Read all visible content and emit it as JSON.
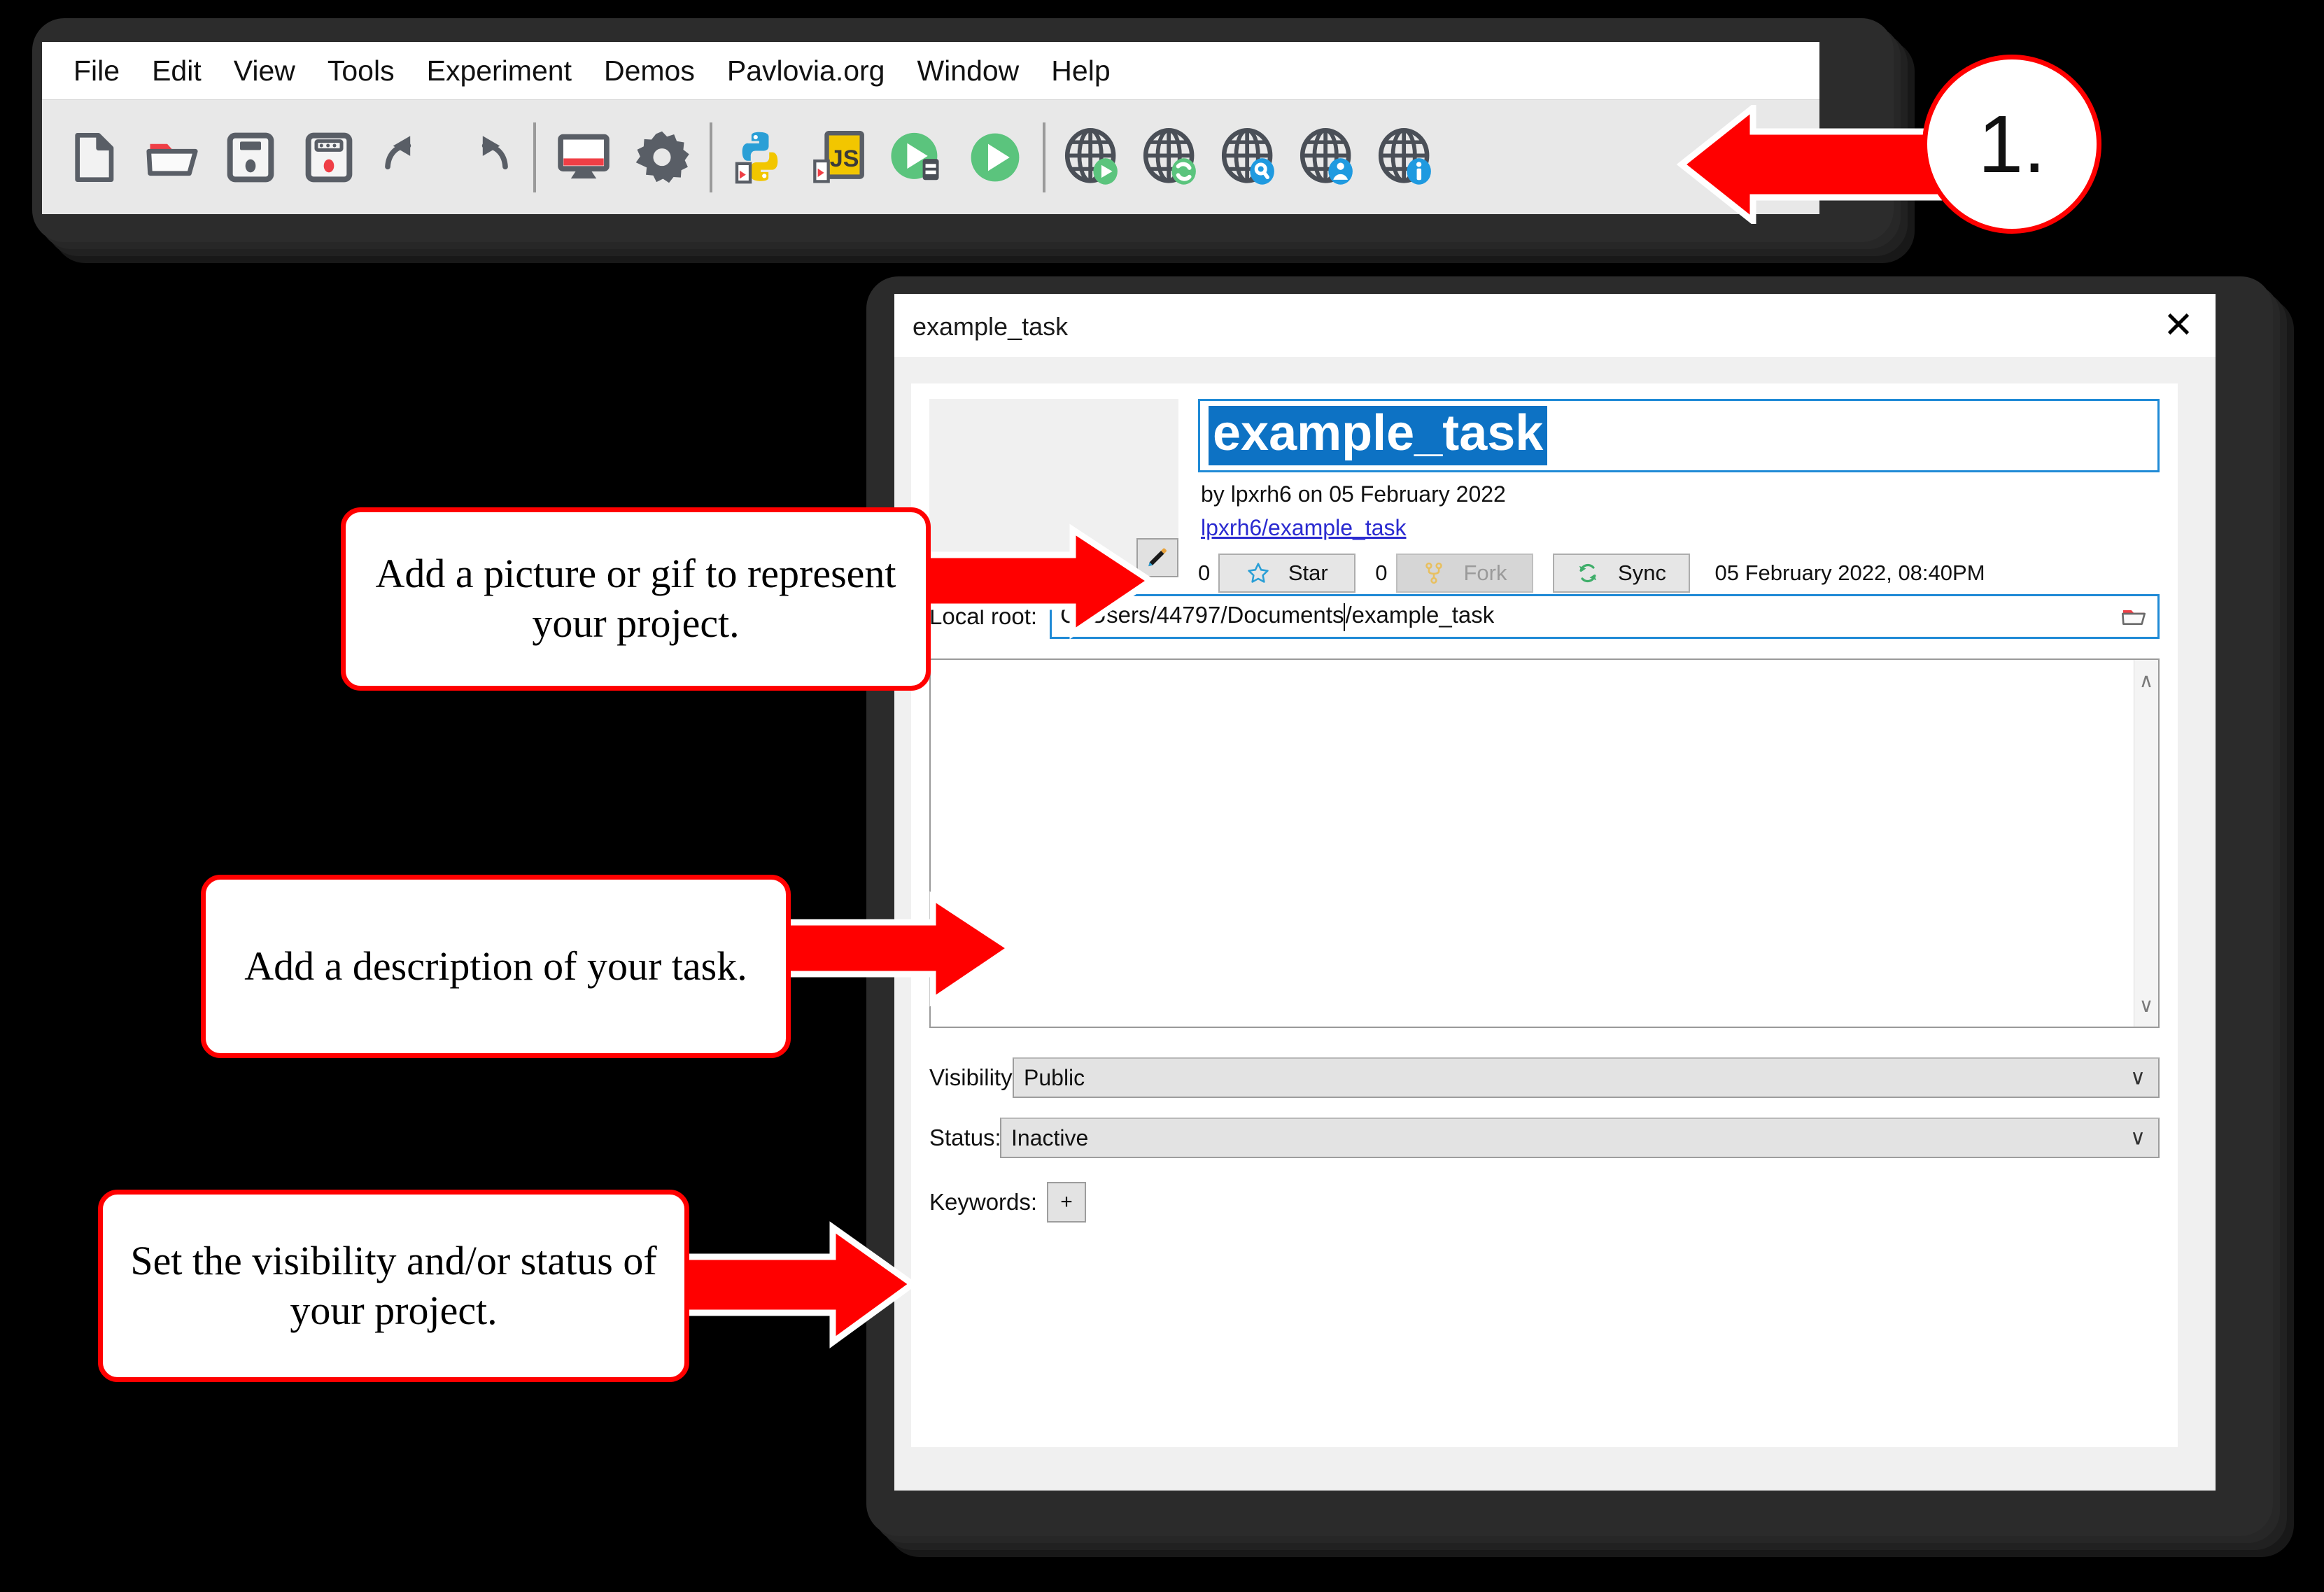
{
  "app": {
    "menubar": [
      {
        "label": "File"
      },
      {
        "label": "Edit"
      },
      {
        "label": "View"
      },
      {
        "label": "Tools"
      },
      {
        "label": "Experiment"
      },
      {
        "label": "Demos"
      },
      {
        "label": "Pavlovia.org"
      },
      {
        "label": "Window"
      },
      {
        "label": "Help"
      }
    ],
    "toolbar": [
      {
        "icon": "new-file-icon"
      },
      {
        "icon": "open-folder-icon"
      },
      {
        "icon": "save-icon"
      },
      {
        "icon": "save-as-icon"
      },
      {
        "icon": "undo-icon"
      },
      {
        "icon": "redo-icon"
      },
      {
        "icon": "separator"
      },
      {
        "icon": "monitor-center-icon"
      },
      {
        "icon": "settings-gear-icon"
      },
      {
        "icon": "separator"
      },
      {
        "icon": "compile-python-icon"
      },
      {
        "icon": "compile-js-icon"
      },
      {
        "icon": "run-local-icon"
      },
      {
        "icon": "run-icon"
      },
      {
        "icon": "separator"
      },
      {
        "icon": "pavlovia-run-icon"
      },
      {
        "icon": "pavlovia-sync-icon"
      },
      {
        "icon": "pavlovia-search-icon"
      },
      {
        "icon": "pavlovia-user-icon"
      },
      {
        "icon": "pavlovia-info-icon"
      }
    ]
  },
  "dialog": {
    "title": "example_task",
    "close_label": "✕",
    "project": {
      "name_value": "example_task",
      "byline": "by lpxrh6 on 05 February 2022",
      "repo_link": "lpxrh6/example_task",
      "star_count": "0",
      "star_label": "Star",
      "fork_count": "0",
      "fork_label": "Fork",
      "sync_label": "Sync",
      "sync_date": "05 February 2022, 08:40PM",
      "edit_image_icon": "pencil-icon"
    },
    "local_root": {
      "label": "Local root:",
      "value_before_caret": "C:/Users/44797/Documents",
      "value_after_caret": "/example_task",
      "browse_icon": "folder-icon"
    },
    "description": {
      "value": "",
      "scroll_up": "∧",
      "scroll_down": "∨"
    },
    "visibility": {
      "label": "Visibility:",
      "value": "Public",
      "caret": "∨"
    },
    "status": {
      "label": "Status:",
      "value": "Inactive",
      "caret": "∨"
    },
    "keywords": {
      "label": "Keywords:",
      "add_label": "+"
    }
  },
  "annotations": {
    "step_badge": "1.",
    "callout_picture": "Add a picture or gif to represent your project.",
    "callout_description": "Add a description of your task.",
    "callout_visibility": "Set the visibility and/or status of your project.",
    "accent_red": "#ff0000"
  }
}
